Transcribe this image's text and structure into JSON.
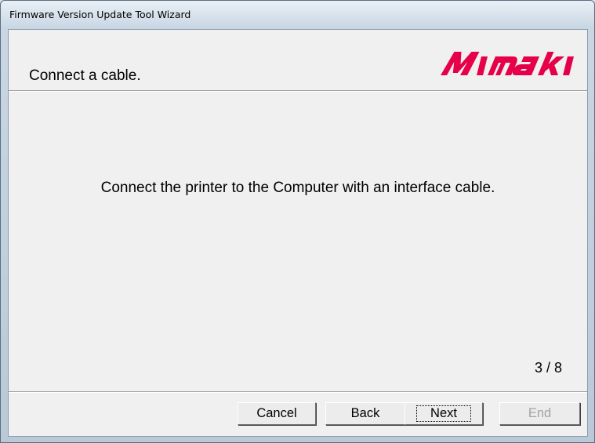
{
  "window": {
    "title": "Firmware Version Update Tool Wizard"
  },
  "header": {
    "heading": "Connect a cable.",
    "logo_text": "MIMAKI",
    "logo_color": "#e6004a"
  },
  "content": {
    "message": "Connect the printer to the Computer with an interface cable."
  },
  "progress": {
    "current_step": 3,
    "total_steps": 8,
    "label": "3 / 8"
  },
  "buttons": {
    "cancel_label": "Cancel",
    "back_label": "Back",
    "next_label": "Next",
    "end_label": "End",
    "end_enabled": false
  }
}
